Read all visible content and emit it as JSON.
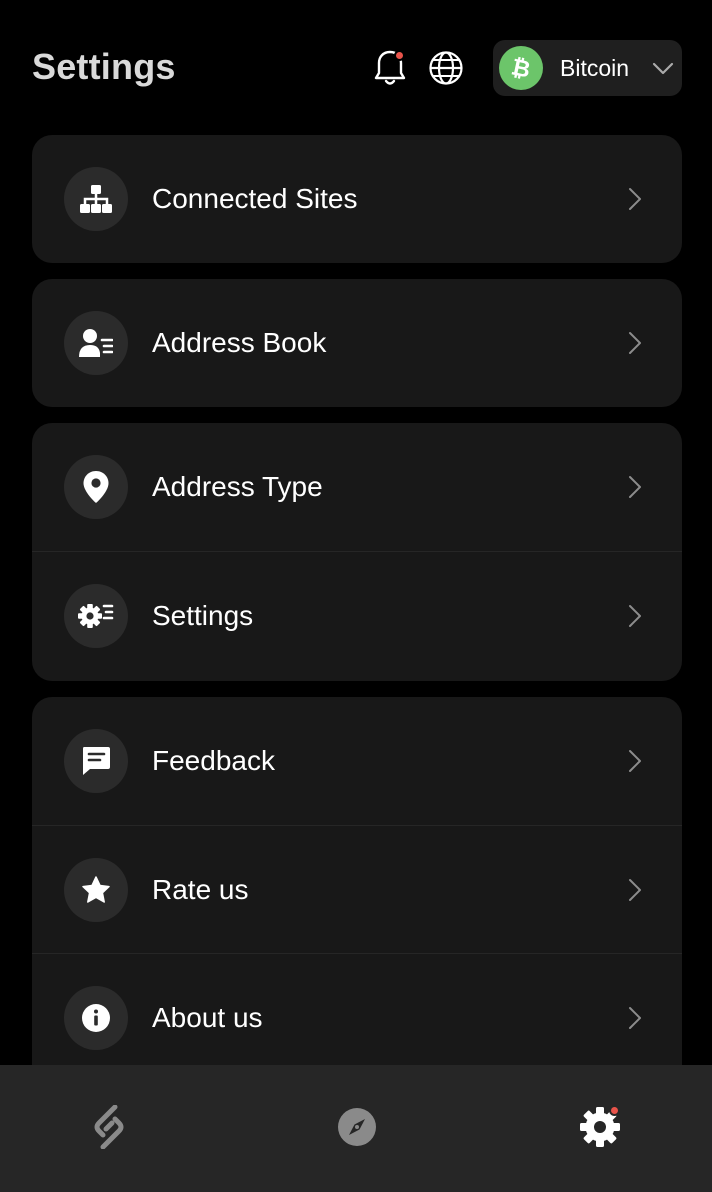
{
  "header": {
    "title": "Settings",
    "notification_icon": "bell-icon",
    "language_icon": "globe-icon",
    "chain_selector": {
      "label": "Bitcoin",
      "icon": "bitcoin-icon",
      "accent": "#6cc56a"
    }
  },
  "groups": [
    {
      "items": [
        {
          "label": "Connected Sites",
          "icon": "sitemap-icon"
        }
      ]
    },
    {
      "items": [
        {
          "label": "Address Book",
          "icon": "contact-list-icon"
        }
      ]
    },
    {
      "items": [
        {
          "label": "Address Type",
          "icon": "location-pin-icon"
        },
        {
          "label": "Settings",
          "icon": "gear-list-icon"
        }
      ]
    },
    {
      "items": [
        {
          "label": "Feedback",
          "icon": "message-icon"
        },
        {
          "label": "Rate us",
          "icon": "star-icon"
        },
        {
          "label": "About us",
          "icon": "info-icon"
        }
      ]
    }
  ],
  "bottom_nav": [
    {
      "name": "wallet",
      "icon": "wallet-logo-icon",
      "active": false
    },
    {
      "name": "discover",
      "icon": "compass-icon",
      "active": false
    },
    {
      "name": "settings",
      "icon": "gear-icon",
      "active": true,
      "badge": true
    }
  ],
  "colors": {
    "background": "#000000",
    "card": "#181818",
    "badge": "#e8534a",
    "nav": "#262626"
  }
}
